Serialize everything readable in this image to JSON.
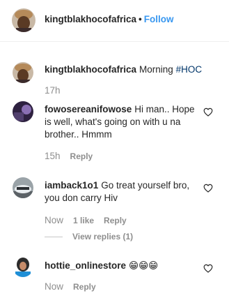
{
  "header": {
    "username": "kingtblakhocofafrica",
    "separator": "•",
    "follow_label": "Follow"
  },
  "caption": {
    "username": "kingtblakhocofafrica",
    "text": "Morning ",
    "hashtag": "#HOC",
    "time": "17h"
  },
  "comments": [
    {
      "username": "fowosereanifowose",
      "text": "Hi man.. Hope is well, what's going on with u na brother.. Hmmm",
      "time": "15h",
      "reply_label": "Reply"
    },
    {
      "username": "iamback1o1",
      "text": "Go treat yourself bro, you don carry Hiv",
      "time": "Now",
      "likes_label": "1 like",
      "reply_label": "Reply",
      "view_replies_label": "View replies (1)"
    },
    {
      "username": "hottie_onlinestore",
      "text": "😁😁😁",
      "time": "Now",
      "reply_label": "Reply"
    }
  ],
  "icons": {
    "heart": "heart-outline-icon"
  }
}
